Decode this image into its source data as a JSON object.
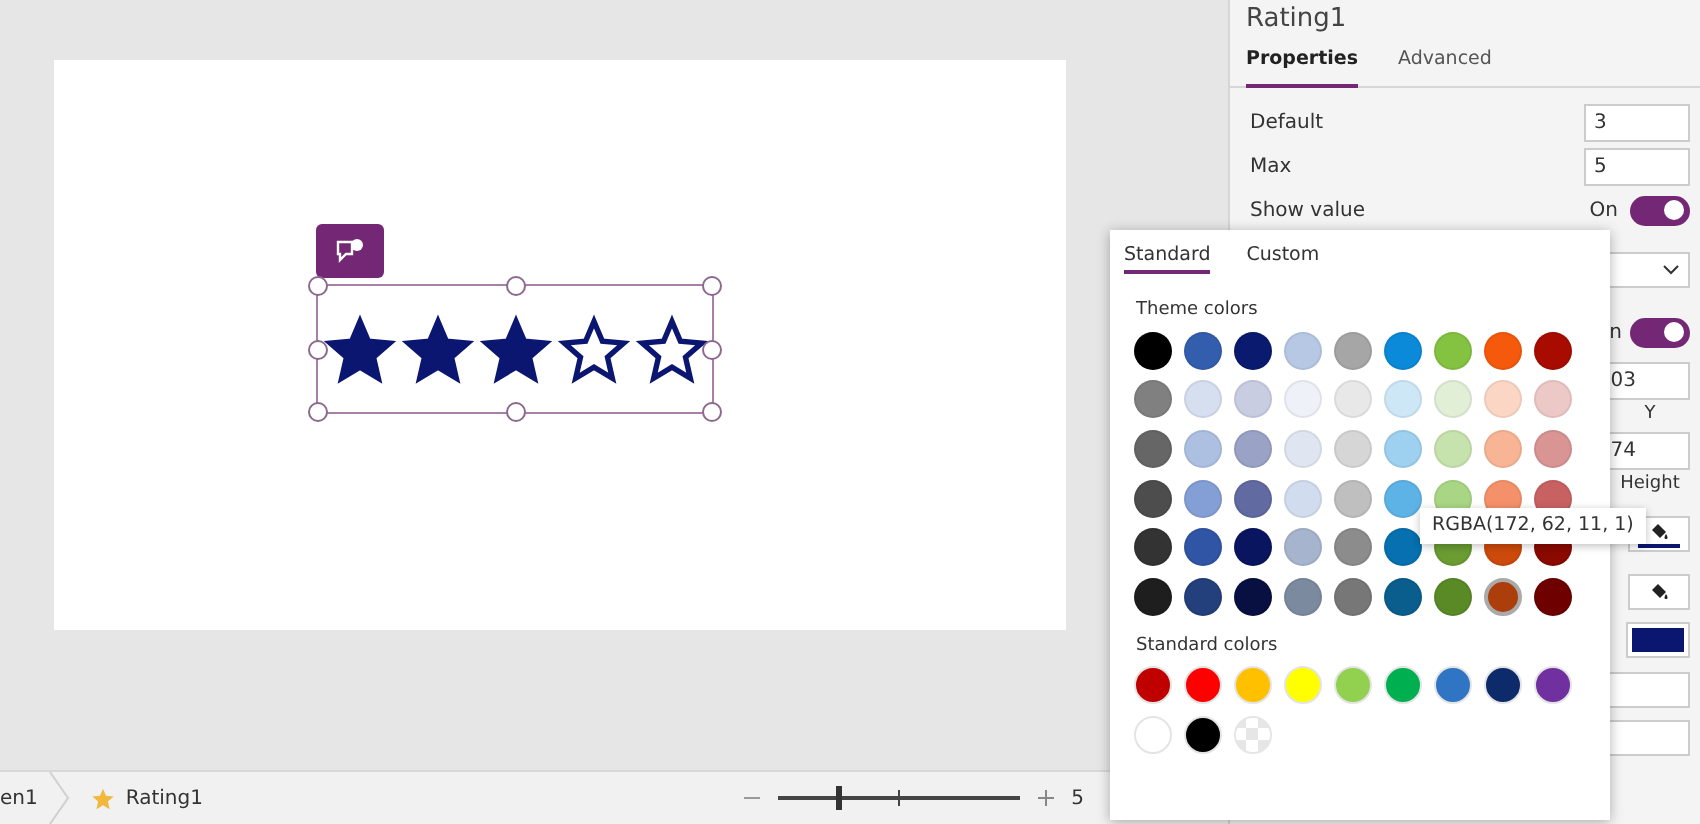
{
  "canvas": {
    "rating": {
      "stars": 3
    }
  },
  "panel": {
    "title": "Rating1",
    "tabs": [
      {
        "label": "Properties",
        "selected": true
      },
      {
        "label": "Advanced",
        "selected": false
      }
    ],
    "properties": [
      {
        "kind": "field",
        "label": "Default",
        "value": "3"
      },
      {
        "kind": "field",
        "label": "Max",
        "value": "5"
      },
      {
        "kind": "toggle",
        "label": "Show value",
        "value": "On",
        "on": true
      }
    ],
    "covered_rows": [
      {
        "kind": "dropdown"
      },
      {
        "kind": "toggle",
        "value": "n",
        "on": true
      },
      {
        "kind": "field",
        "value": "03",
        "caption": "Y"
      },
      {
        "kind": "field",
        "value": "74",
        "caption": "Height"
      },
      {
        "kind": "fill_button",
        "underline": true
      },
      {
        "kind": "fill_button",
        "underline": false
      },
      {
        "kind": "color_swatch",
        "color": "#0a1670"
      },
      {
        "kind": "field"
      },
      {
        "kind": "field"
      }
    ]
  },
  "color_picker": {
    "tabs": [
      {
        "label": "Standard",
        "selected": true
      },
      {
        "label": "Custom",
        "selected": false
      }
    ],
    "theme_label": "Theme colors",
    "theme_colors": [
      [
        {
          "color": "#000000",
          "selected": false
        },
        {
          "color": "#335eae",
          "selected": false
        },
        {
          "color": "#0a1a6e",
          "selected": false
        },
        {
          "color": "#b6c8e4",
          "selected": false
        },
        {
          "color": "#a6a6a6",
          "selected": false
        },
        {
          "color": "#0a8ad8",
          "selected": false
        },
        {
          "color": "#84c341",
          "selected": false
        },
        {
          "color": "#f55a0c",
          "selected": false
        },
        {
          "color": "#a80c00",
          "selected": false
        }
      ],
      [
        {
          "color": "#808080",
          "selected": false
        },
        {
          "color": "#d6dff0",
          "selected": false
        },
        {
          "color": "#c9cde2",
          "selected": false
        },
        {
          "color": "#eef1f7",
          "selected": false
        },
        {
          "color": "#e8e8e8",
          "selected": false
        },
        {
          "color": "#cde7f6",
          "selected": false
        },
        {
          "color": "#e1efd6",
          "selected": false
        },
        {
          "color": "#fbd6c4",
          "selected": false
        },
        {
          "color": "#ecc8c6",
          "selected": false
        }
      ],
      [
        {
          "color": "#666666",
          "selected": false
        },
        {
          "color": "#adc0e2",
          "selected": false
        },
        {
          "color": "#9aa2c6",
          "selected": false
        },
        {
          "color": "#dfe6f1",
          "selected": false
        },
        {
          "color": "#d6d6d6",
          "selected": false
        },
        {
          "color": "#9ed1ef",
          "selected": false
        },
        {
          "color": "#c6e2ad",
          "selected": false
        },
        {
          "color": "#f8b595",
          "selected": false
        },
        {
          "color": "#d99494",
          "selected": false
        }
      ],
      [
        {
          "color": "#4d4d4d",
          "selected": false
        },
        {
          "color": "#849fd6",
          "selected": false
        },
        {
          "color": "#616aa1",
          "selected": false
        },
        {
          "color": "#d1dcee",
          "selected": false
        },
        {
          "color": "#bfbfbf",
          "selected": false
        },
        {
          "color": "#5eb3e6",
          "selected": false
        },
        {
          "color": "#a9d684",
          "selected": false
        },
        {
          "color": "#f4916a",
          "selected": false
        },
        {
          "color": "#c86262",
          "selected": false
        }
      ],
      [
        {
          "color": "#333333",
          "selected": false
        },
        {
          "color": "#2f55a4",
          "selected": false
        },
        {
          "color": "#0a1560",
          "selected": false
        },
        {
          "color": "#a6b5cd",
          "selected": false
        },
        {
          "color": "#8c8c8c",
          "selected": false
        },
        {
          "color": "#0670b0",
          "selected": false
        },
        {
          "color": "#6a9c32",
          "selected": false
        },
        {
          "color": "#cd4a0c",
          "selected": false
        },
        {
          "color": "#8a0a00",
          "selected": false
        }
      ],
      [
        {
          "color": "#1e1e1e",
          "selected": false
        },
        {
          "color": "#23407c",
          "selected": false
        },
        {
          "color": "#071040",
          "selected": false
        },
        {
          "color": "#7c8aa0",
          "selected": false
        },
        {
          "color": "#777777",
          "selected": false
        },
        {
          "color": "#0a5e8e",
          "selected": false
        },
        {
          "color": "#5a8a26",
          "selected": false
        },
        {
          "color": "#ac3e0b",
          "selected": true
        },
        {
          "color": "#6e0000",
          "selected": false
        }
      ]
    ],
    "tooltip": "RGBA(172, 62, 11, 1)",
    "standard_label": "Standard colors",
    "standard_colors": [
      {
        "kind": "solid",
        "color": "#c00000"
      },
      {
        "kind": "solid",
        "color": "#ff0000"
      },
      {
        "kind": "solid",
        "color": "#ffc000"
      },
      {
        "kind": "solid",
        "color": "#ffff00"
      },
      {
        "kind": "solid",
        "color": "#92d050"
      },
      {
        "kind": "solid",
        "color": "#00b050"
      },
      {
        "kind": "solid",
        "color": "#2f75c4"
      },
      {
        "kind": "solid",
        "color": "#0d2a6b"
      },
      {
        "kind": "solid",
        "color": "#7030a0"
      },
      {
        "kind": "solid",
        "color": "#ffffff"
      },
      {
        "kind": "solid",
        "color": "#000000"
      },
      {
        "kind": "transparent"
      }
    ]
  },
  "status_bar": {
    "breadcrumb": [
      {
        "label": "en1"
      },
      {
        "label": "Rating1"
      }
    ],
    "zoom": {
      "level": 0.25
    },
    "zoom_value": "5"
  }
}
